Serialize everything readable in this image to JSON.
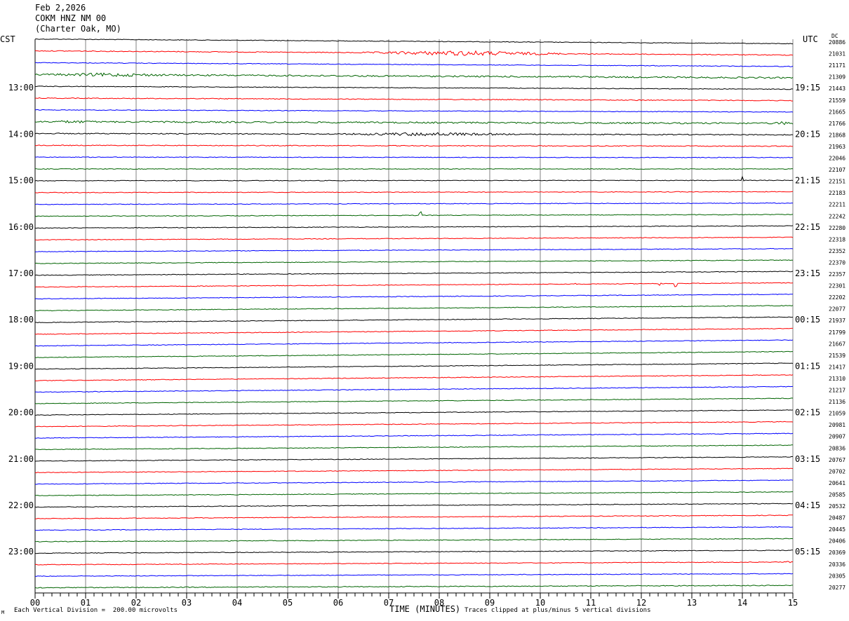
{
  "header": {
    "date": "Feb 2,2026",
    "station": "COKM HNZ NM 00",
    "location": "(Charter Oak, MO)"
  },
  "left_axis_label": "CST",
  "right_axis_label": "UTC",
  "dc_label": "DC",
  "footer": {
    "scale_note": "Each Vertical Division =  200.00 microvolts",
    "clip_note": "Traces clipped at plus/minus 5 vertical divisions",
    "corner_mark": "M"
  },
  "colors": {
    "trace_cycle": [
      "#000000",
      "#ff0000",
      "#0000ff",
      "#006400"
    ],
    "grid": "#808080"
  },
  "chart_data": {
    "type": "line",
    "title": "Feb 2,2026 COKM HNZ NM 00 (Charter Oak, MO)",
    "xlabel": "TIME (MINUTES)",
    "ylabel": "",
    "xlim": [
      0,
      15
    ],
    "x_ticks": [
      "00",
      "01",
      "02",
      "03",
      "04",
      "05",
      "06",
      "07",
      "08",
      "09",
      "10",
      "11",
      "12",
      "13",
      "14",
      "15"
    ],
    "left_time_labels": [
      {
        "row": 4,
        "text": "13:00"
      },
      {
        "row": 8,
        "text": "14:00"
      },
      {
        "row": 12,
        "text": "15:00"
      },
      {
        "row": 16,
        "text": "16:00"
      },
      {
        "row": 20,
        "text": "17:00"
      },
      {
        "row": 24,
        "text": "18:00"
      },
      {
        "row": 28,
        "text": "19:00"
      },
      {
        "row": 32,
        "text": "20:00"
      },
      {
        "row": 36,
        "text": "21:00"
      },
      {
        "row": 40,
        "text": "22:00"
      },
      {
        "row": 44,
        "text": "23:00"
      }
    ],
    "right_time_labels": [
      {
        "row": 4,
        "text": "19:15"
      },
      {
        "row": 8,
        "text": "20:15"
      },
      {
        "row": 12,
        "text": "21:15"
      },
      {
        "row": 16,
        "text": "22:15"
      },
      {
        "row": 20,
        "text": "23:15"
      },
      {
        "row": 24,
        "text": "00:15"
      },
      {
        "row": 28,
        "text": "01:15"
      },
      {
        "row": 32,
        "text": "02:15"
      },
      {
        "row": 36,
        "text": "03:15"
      },
      {
        "row": 40,
        "text": "04:15"
      },
      {
        "row": 44,
        "text": "05:15"
      }
    ],
    "dc_offsets": [
      20886,
      21031,
      21171,
      21309,
      21443,
      21559,
      21665,
      21766,
      21868,
      21963,
      22046,
      22107,
      22151,
      22183,
      22211,
      22242,
      22280,
      22318,
      22352,
      22370,
      22357,
      22301,
      22202,
      22077,
      21937,
      21799,
      21667,
      21539,
      21417,
      21310,
      21217,
      21136,
      21059,
      20981,
      20907,
      20836,
      20767,
      20702,
      20641,
      20585,
      20532,
      20487,
      20445,
      20406,
      20369,
      20336,
      20305,
      20277
    ],
    "drift": [
      0.55,
      0.5,
      0.45,
      0.4,
      0.35,
      0.3,
      0.25,
      0.2,
      0.15,
      0.1,
      0.05,
      0,
      -0.05,
      -0.1,
      -0.15,
      -0.2,
      -0.25,
      -0.3,
      -0.35,
      -0.4,
      -0.45,
      -0.5,
      -0.55,
      -0.6,
      -0.65,
      -0.68,
      -0.7,
      -0.7,
      -0.7,
      -0.68,
      -0.65,
      -0.62,
      -0.6,
      -0.58,
      -0.55,
      -0.52,
      -0.5,
      -0.48,
      -0.46,
      -0.44,
      -0.42,
      -0.4,
      -0.38,
      -0.36,
      -0.34,
      -0.32,
      -0.3,
      -0.28
    ],
    "noise": [
      0.08,
      0.1,
      0.08,
      0.18,
      0.08,
      0.1,
      0.08,
      0.18,
      0.12,
      0.1,
      0.08,
      0.08,
      0.08,
      0.08,
      0.08,
      0.08,
      0.08,
      0.08,
      0.08,
      0.08,
      0.08,
      0.08,
      0.08,
      0.08,
      0.08,
      0.08,
      0.08,
      0.08,
      0.08,
      0.08,
      0.08,
      0.08,
      0.08,
      0.08,
      0.08,
      0.08,
      0.08,
      0.08,
      0.08,
      0.08,
      0.08,
      0.08,
      0.08,
      0.08,
      0.08,
      0.08,
      0.08,
      0.1
    ],
    "events": [
      {
        "row": 1,
        "start_min": 6.5,
        "end_min": 10.5,
        "amp": 0.6
      },
      {
        "row": 3,
        "start_min": 0.0,
        "end_min": 3.0,
        "amp": 0.45
      },
      {
        "row": 5,
        "start_min": 11.5,
        "end_min": 12.5,
        "amp": 0.15
      },
      {
        "row": 7,
        "start_min": 0.0,
        "end_min": 1.5,
        "amp": 0.35
      },
      {
        "row": 7,
        "start_min": 14.6,
        "end_min": 15.0,
        "amp": 0.5
      },
      {
        "row": 8,
        "start_min": 6.0,
        "end_min": 9.5,
        "amp": 0.45
      },
      {
        "row": 12,
        "start_min": 14.0,
        "end_min": 14.05,
        "amp": 1.1
      },
      {
        "row": 15,
        "start_min": 7.6,
        "end_min": 7.65,
        "amp": 1.0
      },
      {
        "row": 21,
        "start_min": 10.65,
        "end_min": 10.7,
        "amp": 0.5
      },
      {
        "row": 21,
        "start_min": 12.35,
        "end_min": 12.4,
        "amp": 0.5
      },
      {
        "row": 21,
        "start_min": 12.65,
        "end_min": 12.7,
        "amp": 0.9
      },
      {
        "row": 45,
        "start_min": 14.8,
        "end_min": 15.0,
        "amp": 0.25
      }
    ]
  }
}
